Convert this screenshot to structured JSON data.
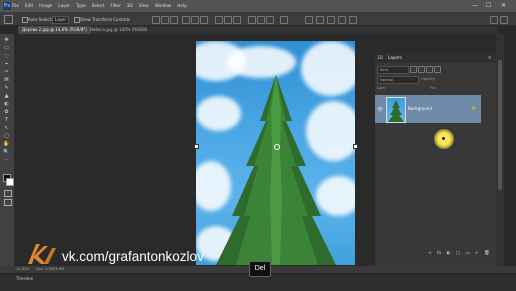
{
  "app": {
    "logo": "Ps"
  },
  "menu": [
    "File",
    "Edit",
    "Image",
    "Layer",
    "Type",
    "Select",
    "Filter",
    "3D",
    "View",
    "Window",
    "Help"
  ],
  "window_controls": {
    "minimize": "—",
    "maximize": "☐",
    "close": "✕"
  },
  "options_bar": {
    "auto_select_label": "Auto-Select:",
    "auto_select_value": "Layer",
    "transform_label": "Show Transform Controls"
  },
  "tabs": [
    {
      "label": "Дерево 2.jpg @ 14,6% (RGB/8*)",
      "active": true
    },
    {
      "label": "Небеса.jpg @ 100% (RGB/8)",
      "active": false
    }
  ],
  "tools": [
    "✥",
    "▭",
    "◌",
    "⌖",
    "✂",
    "⌘",
    "✎",
    "▲",
    "◐",
    "✿",
    "T",
    "↖",
    "▢",
    "✋",
    "🔍",
    "⋯"
  ],
  "layers_panel": {
    "tab_3d": "3D",
    "tab_layers": "Layers",
    "kind_label": "Kind",
    "mode_label": "Normal",
    "opacity_label": "Opacity:",
    "lock_label": "Lock:",
    "fill_label": "Fill:",
    "layer": {
      "name": "Background",
      "lock_icon": "lock-icon"
    },
    "bottom_icons": [
      "fx",
      "◐",
      "▢",
      "▭",
      "+",
      "🗑"
    ]
  },
  "status": {
    "zoom": "14,63%",
    "info": "Doc: 4,5M/4,5M"
  },
  "timeline_label": "Timeline",
  "overlay": {
    "watermark": "vk.com/grafantonkozlov",
    "key_label": "Del",
    "highlight_color": "#f5e24b"
  },
  "colors": {
    "layer_selected": "#6d8aa8",
    "sky": "#3ea0dd"
  }
}
